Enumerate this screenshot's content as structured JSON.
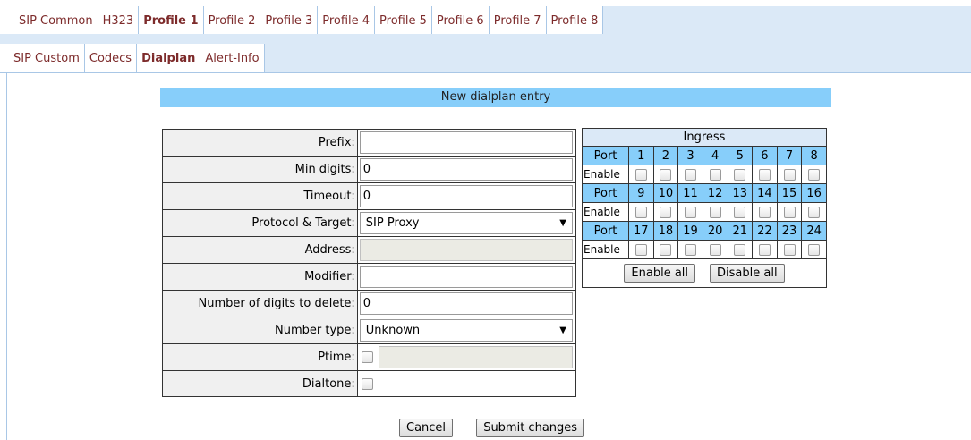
{
  "top_tabs": [
    "SIP Common",
    "H323",
    "Profile 1",
    "Profile 2",
    "Profile 3",
    "Profile 4",
    "Profile 5",
    "Profile 6",
    "Profile 7",
    "Profile 8"
  ],
  "active_top_tab": "Profile 1",
  "sub_tabs": [
    "SIP Custom",
    "Codecs",
    "Dialplan",
    "Alert-Info"
  ],
  "active_sub_tab": "Dialplan",
  "section_title": "New dialplan entry",
  "form": {
    "prefix_label": "Prefix:",
    "prefix_value": "",
    "min_digits_label": "Min digits:",
    "min_digits_value": "0",
    "timeout_label": "Timeout:",
    "timeout_value": "0",
    "protocol_label": "Protocol & Target:",
    "protocol_value": "SIP Proxy",
    "address_label": "Address:",
    "address_value": "",
    "modifier_label": "Modifier:",
    "modifier_value": "",
    "digits_delete_label": "Number of digits to delete:",
    "digits_delete_value": "0",
    "number_type_label": "Number type:",
    "number_type_value": "Unknown",
    "ptime_label": "Ptime:",
    "ptime_value": "",
    "dialtone_label": "Dialtone:"
  },
  "ingress": {
    "title": "Ingress",
    "port_label": "Port",
    "enable_label": "Enable",
    "port_rows": [
      [
        "1",
        "2",
        "3",
        "4",
        "5",
        "6",
        "7",
        "8"
      ],
      [
        "9",
        "10",
        "11",
        "12",
        "13",
        "14",
        "15",
        "16"
      ],
      [
        "17",
        "18",
        "19",
        "20",
        "21",
        "22",
        "23",
        "24"
      ]
    ],
    "enable_all_label": "Enable all",
    "disable_all_label": "Disable all"
  },
  "actions": {
    "cancel_label": "Cancel",
    "submit_label": "Submit changes"
  },
  "colors": {
    "tab_text": "#7d2b2b",
    "header_bg": "#87cefa",
    "tabbar_bg": "#dbe9f7"
  }
}
